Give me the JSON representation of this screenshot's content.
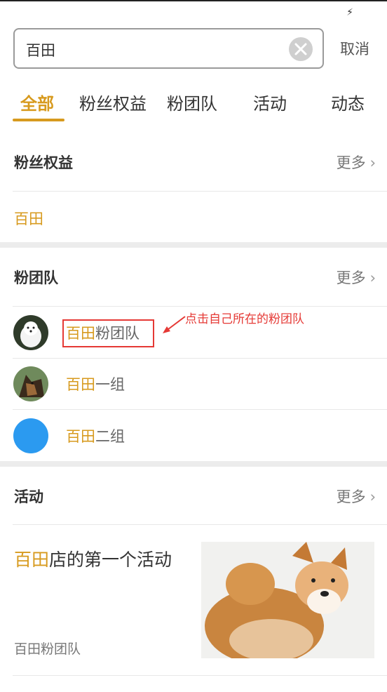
{
  "status_bar": {
    "icon": "charging-bolt-icon"
  },
  "search": {
    "query": "百田",
    "cancel_label": "取消"
  },
  "tabs": [
    {
      "label": "全部",
      "active": true
    },
    {
      "label": "粉丝权益",
      "active": false
    },
    {
      "label": "粉团队",
      "active": false
    },
    {
      "label": "活动",
      "active": false
    },
    {
      "label": "动态",
      "active": false
    }
  ],
  "colors": {
    "accent": "#d79a1e",
    "annotation": "#e53935",
    "divider": "#ececec"
  },
  "sections": {
    "fan_rights": {
      "title": "粉丝权益",
      "more_label": "更多",
      "items": [
        {
          "highlight": "百田",
          "rest": ""
        }
      ]
    },
    "fan_groups": {
      "title": "粉团队",
      "more_label": "更多",
      "items": [
        {
          "highlight": "百田",
          "rest": "粉团队",
          "avatar": "white-dog-avatar"
        },
        {
          "highlight": "百田",
          "rest": "一组",
          "avatar": "shepherd-dog-avatar"
        },
        {
          "highlight": "百田",
          "rest": "二组",
          "avatar": "blue-circle-avatar"
        }
      ]
    },
    "activities": {
      "title": "活动",
      "more_label": "更多",
      "items": [
        {
          "highlight": "百田",
          "rest": "店的第一个活动",
          "subtitle": "百田粉团队",
          "image": "shiba-dog-image"
        }
      ]
    }
  },
  "annotation": {
    "text": "点击自己所在的粉团队"
  }
}
